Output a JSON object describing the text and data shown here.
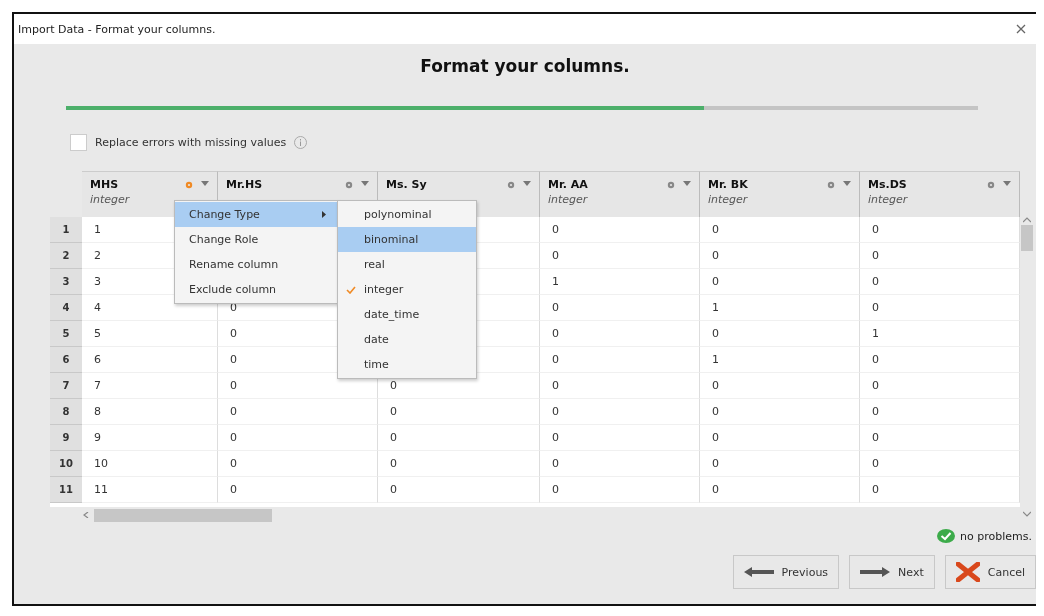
{
  "window": {
    "title": "Import Data - Format your columns."
  },
  "heading": "Format your columns.",
  "progress": {
    "level": 0.7
  },
  "replace_errors": {
    "label": "Replace errors with missing values",
    "checked": false
  },
  "columns": [
    {
      "name": "MHS",
      "type": "integer",
      "active": true
    },
    {
      "name": "Mr.HS",
      "active": false
    },
    {
      "name": "Ms. Sy",
      "active": false
    },
    {
      "name": "Mr. AA",
      "type": "integer",
      "active": false
    },
    {
      "name": "Mr. BK",
      "type": "integer",
      "active": false
    },
    {
      "name": "Ms.DS",
      "type": "integer",
      "active": false
    }
  ],
  "rows": [
    {
      "number": "1",
      "cells": [
        "1",
        null,
        null,
        "0",
        "0",
        "0"
      ]
    },
    {
      "number": "2",
      "cells": [
        "2",
        null,
        null,
        "0",
        "0",
        "0"
      ]
    },
    {
      "number": "3",
      "cells": [
        "3",
        null,
        null,
        "1",
        "0",
        "0"
      ]
    },
    {
      "number": "4",
      "cells": [
        "4",
        "0",
        null,
        "0",
        "1",
        "0"
      ]
    },
    {
      "number": "5",
      "cells": [
        "5",
        "0",
        null,
        "0",
        "0",
        "1"
      ]
    },
    {
      "number": "6",
      "cells": [
        "6",
        "0",
        null,
        "0",
        "1",
        "0"
      ]
    },
    {
      "number": "7",
      "cells": [
        "7",
        "0",
        "0",
        "0",
        "0",
        "0"
      ]
    },
    {
      "number": "8",
      "cells": [
        "8",
        "0",
        "0",
        "0",
        "0",
        "0"
      ]
    },
    {
      "number": "9",
      "cells": [
        "9",
        "0",
        "0",
        "0",
        "0",
        "0"
      ]
    },
    {
      "number": "10",
      "cells": [
        "10",
        "0",
        "0",
        "0",
        "0",
        "0"
      ]
    },
    {
      "number": "11",
      "cells": [
        "11",
        "0",
        "0",
        "0",
        "0",
        "0"
      ]
    }
  ],
  "context_menu": [
    {
      "label": "Change Type",
      "selected": true,
      "submenu": true
    },
    {
      "label": "Change Role",
      "selected": false,
      "submenu": false
    },
    {
      "label": "Rename column",
      "selected": false,
      "submenu": false
    },
    {
      "label": "Exclude column",
      "selected": false,
      "submenu": false
    }
  ],
  "type_menu": [
    {
      "label": "polynominal",
      "selected": false,
      "checked": false
    },
    {
      "label": "binominal",
      "selected": true,
      "checked": false
    },
    {
      "label": "real",
      "selected": false,
      "checked": false
    },
    {
      "label": "integer",
      "selected": false,
      "checked": true
    },
    {
      "label": "date_time",
      "selected": false,
      "checked": false
    },
    {
      "label": "date",
      "selected": false,
      "checked": false
    },
    {
      "label": "time",
      "selected": false,
      "checked": false
    }
  ],
  "status": "no problems.",
  "buttons": [
    {
      "label": "Previous",
      "kind": "previous"
    },
    {
      "label": "Next",
      "kind": "next"
    },
    {
      "label": "Cancel",
      "kind": "cancel"
    }
  ]
}
